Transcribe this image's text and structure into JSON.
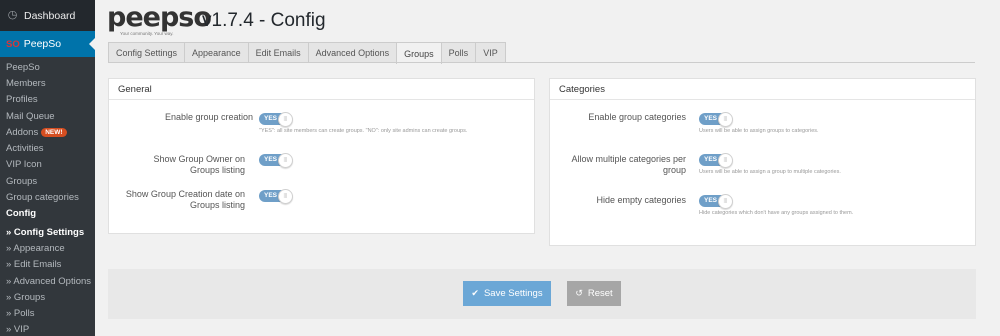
{
  "sidebar": {
    "dashboard_label": "Dashboard",
    "dashboard_icon": "gauge-icon",
    "peepso_label": "PeepSo",
    "peepso_logo_text": "SO",
    "items": [
      {
        "label": "PeepSo"
      },
      {
        "label": "Members"
      },
      {
        "label": "Profiles"
      },
      {
        "label": "Mail Queue"
      },
      {
        "label": "Addons",
        "badge": "NEW!"
      },
      {
        "label": "Activities"
      },
      {
        "label": "VIP Icon"
      },
      {
        "label": "Groups"
      },
      {
        "label": "Group categories"
      },
      {
        "label": "Config",
        "current": true
      }
    ],
    "config_sub": [
      {
        "label": "» Config Settings",
        "current": true
      },
      {
        "label": "» Appearance"
      },
      {
        "label": "» Edit Emails"
      },
      {
        "label": "» Advanced Options"
      },
      {
        "label": "» Groups"
      },
      {
        "label": "» Polls"
      },
      {
        "label": "» VIP"
      }
    ]
  },
  "header": {
    "brand": "peepso",
    "tagline": "Your community. Your way.",
    "title": "v1.7.4 - Config"
  },
  "tabs": [
    {
      "label": "Config Settings"
    },
    {
      "label": "Appearance"
    },
    {
      "label": "Edit Emails"
    },
    {
      "label": "Advanced Options"
    },
    {
      "label": "Groups",
      "active": true
    },
    {
      "label": "Polls"
    },
    {
      "label": "VIP"
    }
  ],
  "general": {
    "title": "General",
    "rows": [
      {
        "label": "Enable group creation",
        "toggle": "YES",
        "help": "\"YES\": all site members can create groups. \"NO\": only site admins can create groups."
      },
      {
        "label": "Show Group Owner on Groups listing",
        "toggle": "YES"
      },
      {
        "label": "Show Group Creation date on Groups listing",
        "toggle": "YES"
      }
    ]
  },
  "categories": {
    "title": "Categories",
    "rows": [
      {
        "label": "Enable group categories",
        "toggle": "YES",
        "help": "Users will be able to assign groups to categories."
      },
      {
        "label": "Allow multiple categories per group",
        "toggle": "YES",
        "help": "Users will be able to assign a group to multiple categories."
      },
      {
        "label": "Hide empty categories",
        "toggle": "YES",
        "help": "Hide categories which don't have any groups assigned to them."
      }
    ]
  },
  "footer": {
    "save_label": "Save Settings",
    "reset_label": "Reset"
  },
  "colors": {
    "sidebar_bg": "#23282d",
    "active_menu": "#0073aa",
    "toggle_on": "#6f9fc8",
    "save_button": "#6ba7d6",
    "reset_button": "#a6a6a6"
  }
}
